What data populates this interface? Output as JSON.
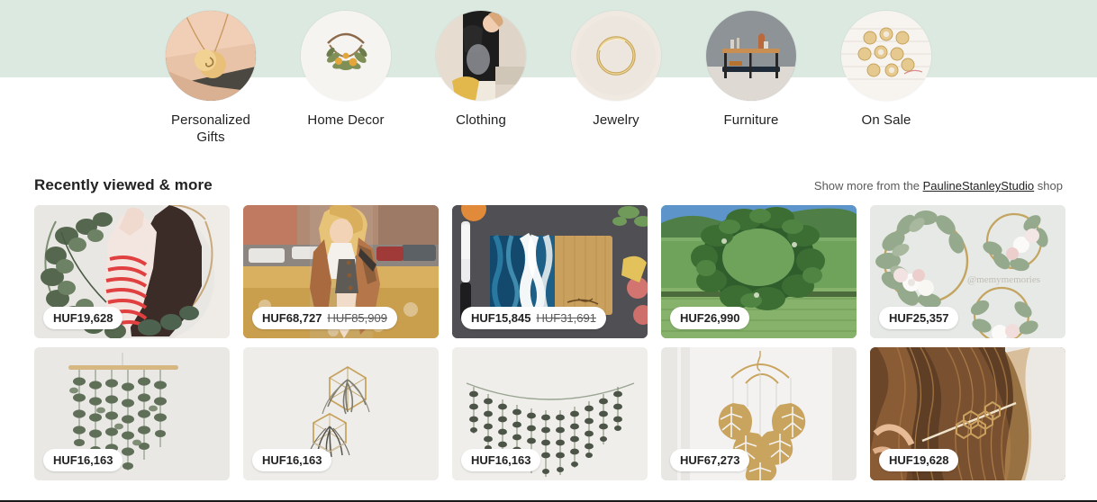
{
  "theme": {
    "hero_band_color": "#dbe9e0",
    "page_background": "#ffffff",
    "text_color": "#222222",
    "muted_text_color": "#595959"
  },
  "categories": [
    {
      "label": "Personalized Gifts",
      "icon": "necklace-photo"
    },
    {
      "label": "Home Decor",
      "icon": "wreath-photo"
    },
    {
      "label": "Clothing",
      "icon": "clothing-photo"
    },
    {
      "label": "Jewelry",
      "icon": "bangle-photo"
    },
    {
      "label": "Furniture",
      "icon": "console-table-photo"
    },
    {
      "label": "On Sale",
      "icon": "sale-items-photo"
    }
  ],
  "section": {
    "title": "Recently viewed & more",
    "show_more_prefix": "Show more from the",
    "shop_name": "PaulineStanleyStudio",
    "show_more_suffix": "shop"
  },
  "listings": [
    {
      "name": "eucalyptus-hoop-wreath",
      "price": "HUF19,628",
      "original_price": "",
      "art": "wreath-model"
    },
    {
      "name": "tan-trench-coat",
      "price": "HUF68,727",
      "original_price": "HUF85,909",
      "art": "trench-coat"
    },
    {
      "name": "ocean-resin-cutting-board",
      "price": "HUF15,845",
      "original_price": "HUF31,691",
      "art": "cutting-board"
    },
    {
      "name": "green-garden-wreath",
      "price": "HUF26,990",
      "original_price": "",
      "art": "garden-wreath"
    },
    {
      "name": "floral-hoop-wreath-set",
      "price": "HUF25,357",
      "original_price": "",
      "art": "hoop-wreath-set"
    },
    {
      "name": "eucalyptus-wall-hanging",
      "price": "HUF16,163",
      "original_price": "",
      "art": "wall-hanging"
    },
    {
      "name": "geometric-air-plant-holder",
      "price": "HUF16,163",
      "original_price": "",
      "art": "air-plant"
    },
    {
      "name": "lavender-garland",
      "price": "HUF16,163",
      "original_price": "",
      "art": "garland"
    },
    {
      "name": "gold-monstera-mobile",
      "price": "HUF67,273",
      "original_price": "",
      "art": "leaf-mobile"
    },
    {
      "name": "honeycomb-hair-pin",
      "price": "HUF19,628",
      "original_price": "",
      "art": "hair-pin"
    }
  ]
}
